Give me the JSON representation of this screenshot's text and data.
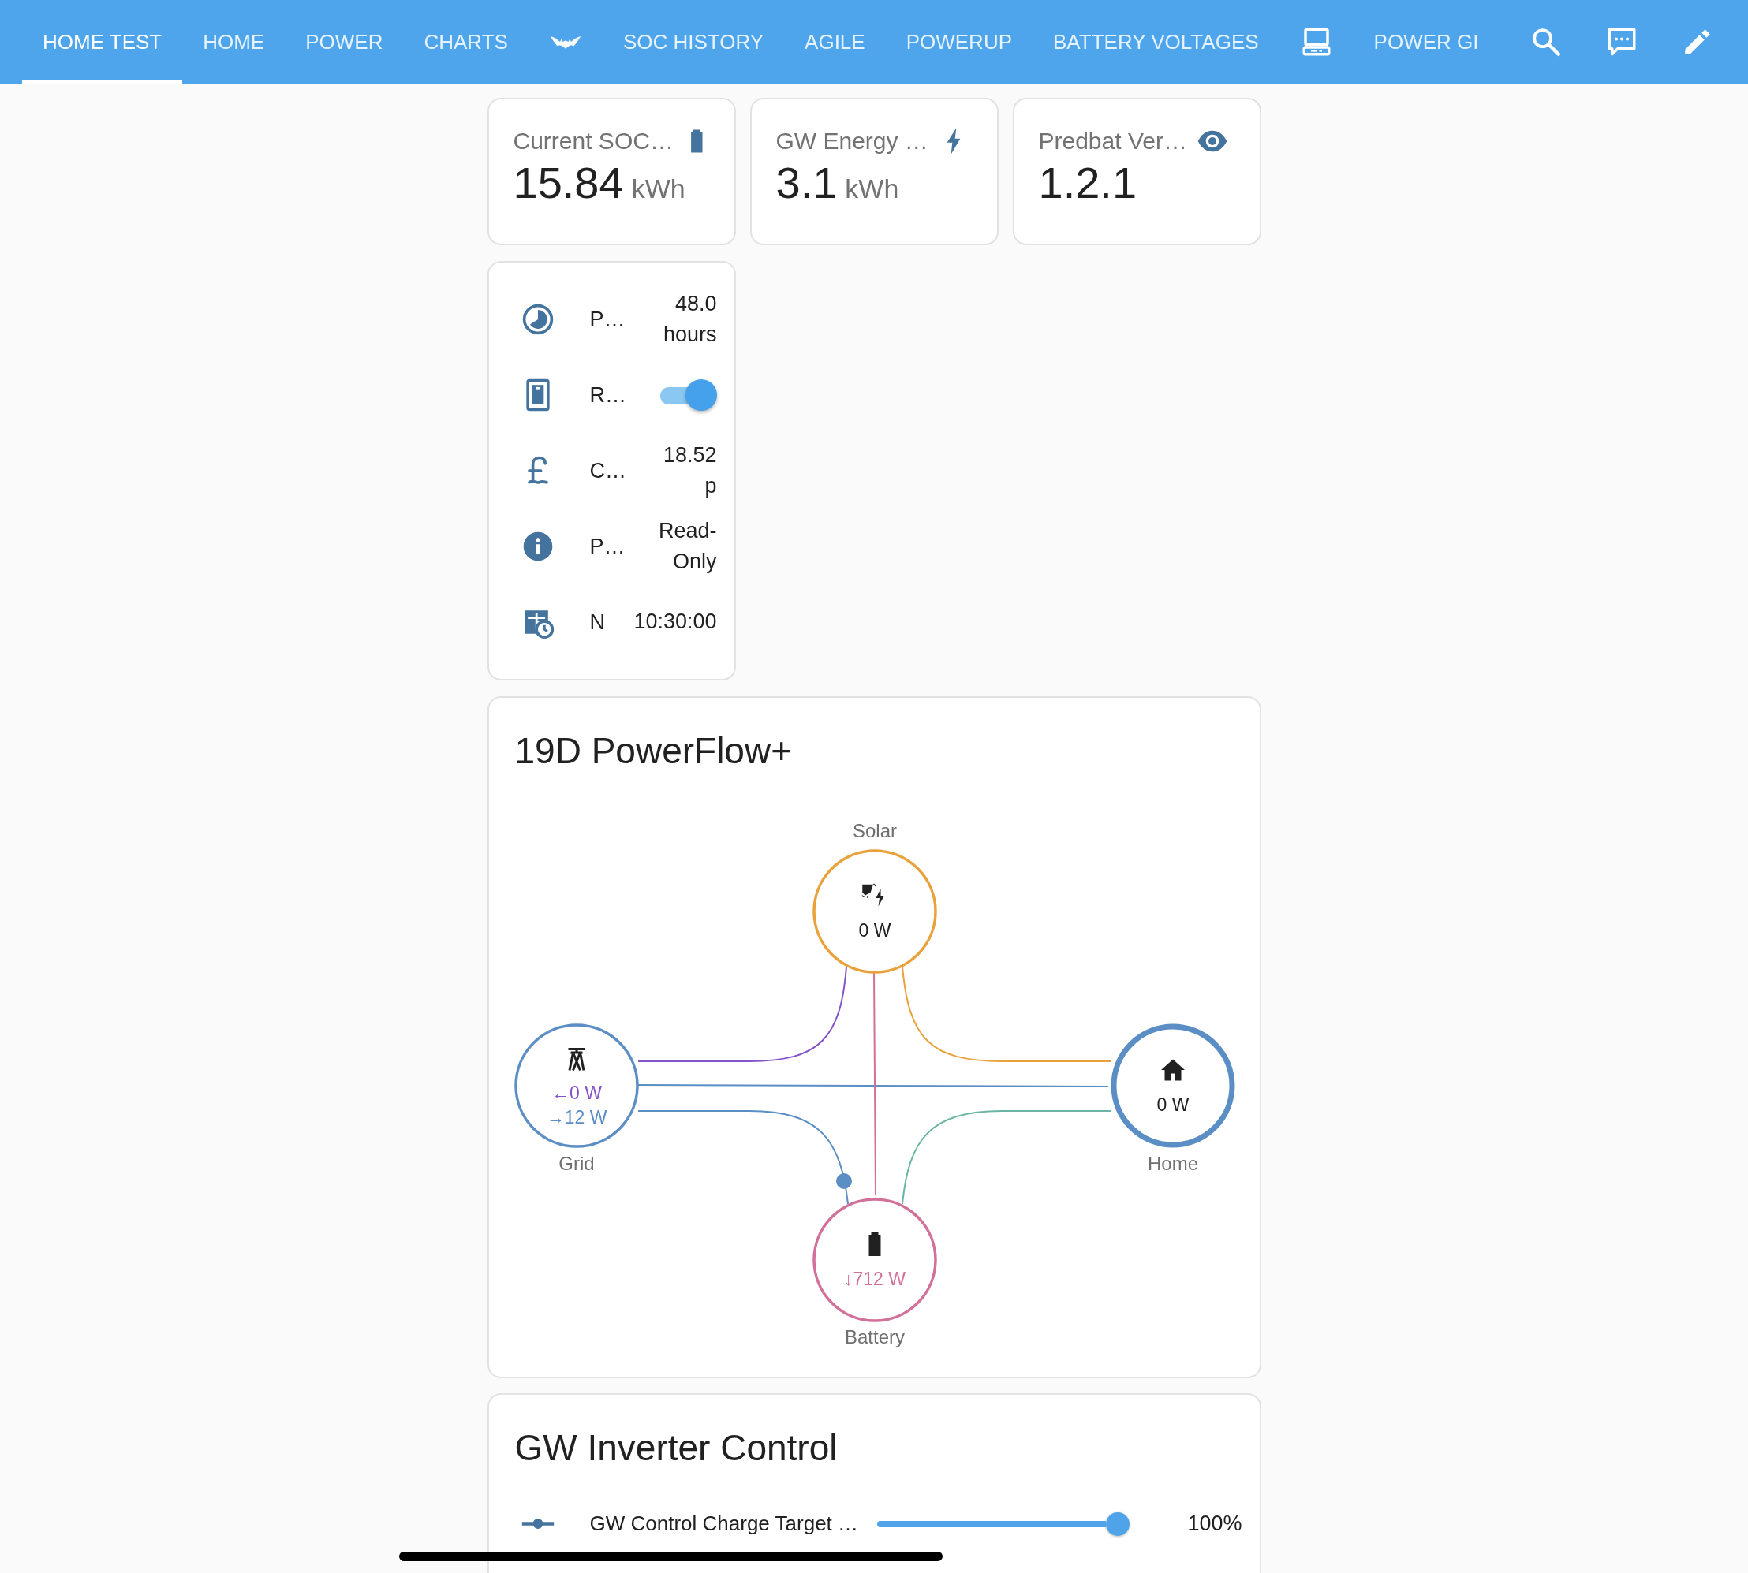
{
  "tabs": [
    {
      "kind": "text",
      "label": "HOME TEST",
      "selected": true
    },
    {
      "kind": "text",
      "label": "HOME",
      "selected": false
    },
    {
      "kind": "text",
      "label": "POWER",
      "selected": false
    },
    {
      "kind": "text",
      "label": "CHARTS",
      "selected": false
    },
    {
      "kind": "icon",
      "selected": false
    },
    {
      "kind": "text",
      "label": "SOC HISTORY",
      "selected": false
    },
    {
      "kind": "text",
      "label": "AGILE",
      "selected": false
    },
    {
      "kind": "text",
      "label": "POWERUP",
      "selected": false
    },
    {
      "kind": "text",
      "label": "BATTERY VOLTAGES",
      "selected": false
    },
    {
      "kind": "icon",
      "selected": false
    },
    {
      "kind": "text",
      "label": "POWER GI",
      "selected": false
    }
  ],
  "stat_cards": [
    {
      "title": "Current SOC…",
      "value": "15.84",
      "unit": "kWh"
    },
    {
      "title": "GW Energy …",
      "value": "3.1",
      "unit": "kWh"
    },
    {
      "title": "Predbat Ver…",
      "value": "1.2.1"
    }
  ],
  "entities": {
    "rows": [
      {
        "kind": "value",
        "name": "P…",
        "value": "48.0 hours"
      },
      {
        "kind": "toggle",
        "name": "R…",
        "on": true
      },
      {
        "kind": "value",
        "name": "C…",
        "value": "18.52 p"
      },
      {
        "kind": "value",
        "name": "P…",
        "value": "Read-Only"
      },
      {
        "kind": "value",
        "name": "N",
        "value": "10:30:00"
      }
    ]
  },
  "powerflow": {
    "title": "19D PowerFlow+",
    "nodes": [
      {
        "kind": "solar",
        "label": "Solar",
        "color": "#e9a23b",
        "readings": [
          {
            "text": "0 W",
            "color": "#212121"
          }
        ]
      },
      {
        "kind": "grid",
        "label": "Grid",
        "color": "#5b8ec4",
        "readings": [
          {
            "text": "←0 W",
            "color": "#8353c9"
          },
          {
            "text": "→12 W",
            "color": "#5b8ec4"
          }
        ]
      },
      {
        "kind": "home",
        "label": "Home",
        "color": "#5b8ec4",
        "readings": [
          {
            "text": "0 W",
            "color": "#212121"
          }
        ]
      },
      {
        "kind": "battery",
        "label": "Battery",
        "color": "#d3709a",
        "readings": [
          {
            "text": "↓712 W",
            "color": "#d3709a"
          }
        ]
      }
    ],
    "flows": [
      {
        "color": "#8353c9"
      },
      {
        "color": "#e9a23b"
      },
      {
        "color": "#5b8ec4"
      },
      {
        "color": "#d3709a"
      },
      {
        "color": "#5b8ec4",
        "dot": true
      },
      {
        "color": "#6bb5a5"
      }
    ]
  },
  "inverter": {
    "title": "GW Inverter Control",
    "rows": [
      {
        "name": "GW Control Charge Target …",
        "level": 1.0,
        "reading": "100%"
      }
    ]
  }
}
